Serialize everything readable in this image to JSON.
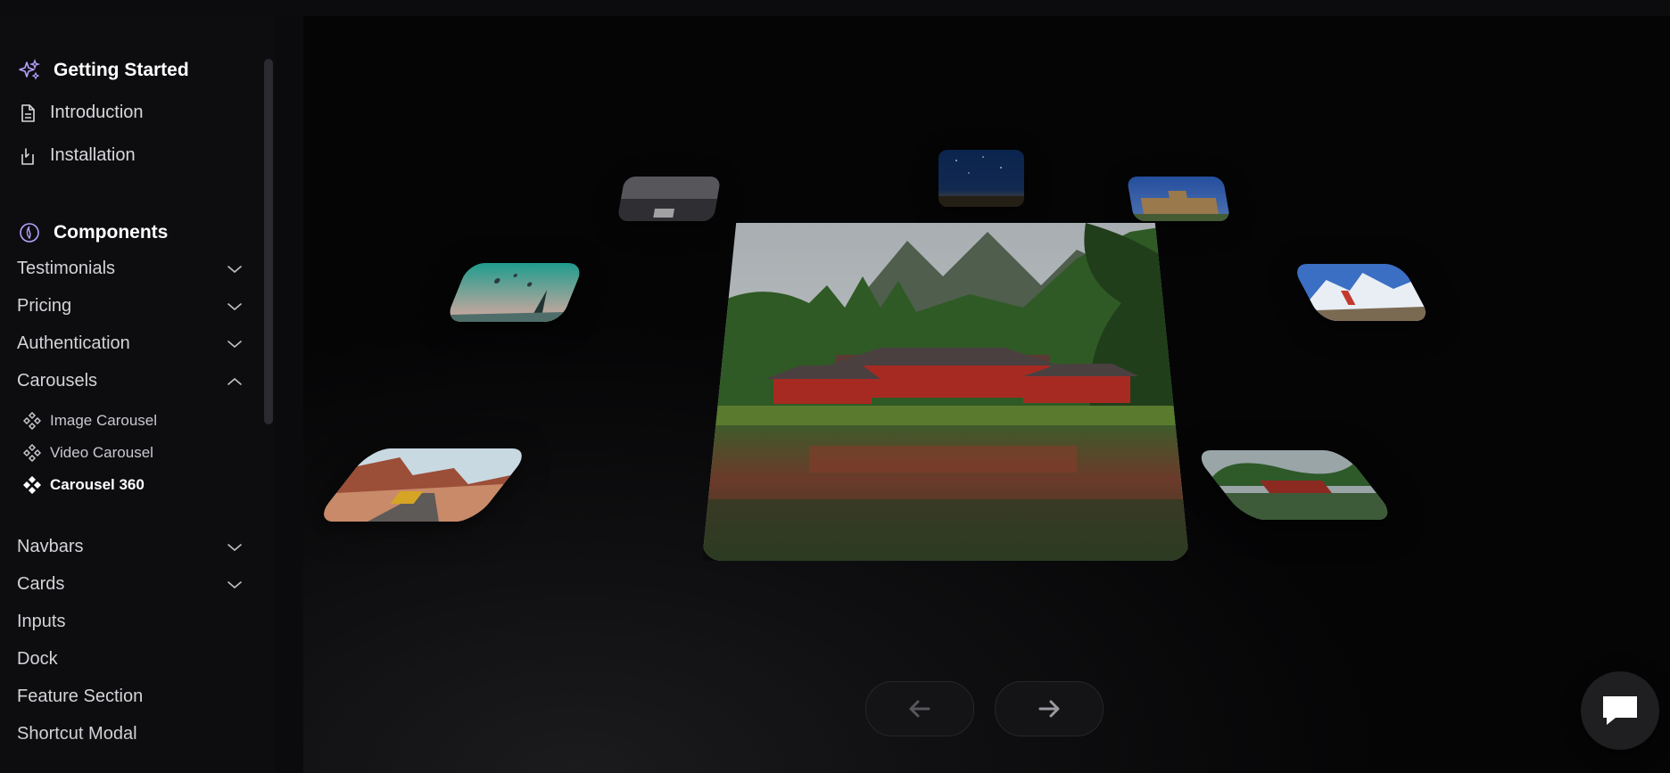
{
  "sidebar": {
    "getting_started": {
      "title": "Getting Started",
      "icon": "sparkles-icon"
    },
    "links": [
      {
        "label": "Introduction",
        "icon": "document-icon"
      },
      {
        "label": "Installation",
        "icon": "install-icon"
      }
    ],
    "components": {
      "title": "Components",
      "icon": "components-icon"
    },
    "groups": [
      {
        "label": "Testimonials",
        "state": "collapsed"
      },
      {
        "label": "Pricing",
        "state": "collapsed"
      },
      {
        "label": "Authentication",
        "state": "collapsed"
      },
      {
        "label": "Carousels",
        "state": "expanded"
      }
    ],
    "carousel_items": [
      {
        "label": "Image Carousel",
        "active": false
      },
      {
        "label": "Video Carousel",
        "active": false
      },
      {
        "label": "Carousel 360",
        "active": true
      }
    ],
    "more_groups": [
      {
        "label": "Navbars",
        "state": "collapsed"
      },
      {
        "label": "Cards",
        "state": "collapsed"
      }
    ],
    "plain_items": [
      "Inputs",
      "Dock",
      "Feature Section",
      "Shortcut Modal"
    ]
  },
  "carousel": {
    "images": [
      "desert-road",
      "balloons-teal",
      "city-dusk",
      "starry-night",
      "palace",
      "mountain-hiker",
      "red-temple-small",
      "red-temple-featured"
    ],
    "prev_icon": "arrow-left-icon",
    "next_icon": "arrow-right-icon"
  },
  "chat": {
    "icon": "chat-bubble-icon"
  },
  "colors": {
    "background": "#0a0a0b",
    "sidebar": "#0d0d10",
    "accent": "#a78bfa"
  }
}
